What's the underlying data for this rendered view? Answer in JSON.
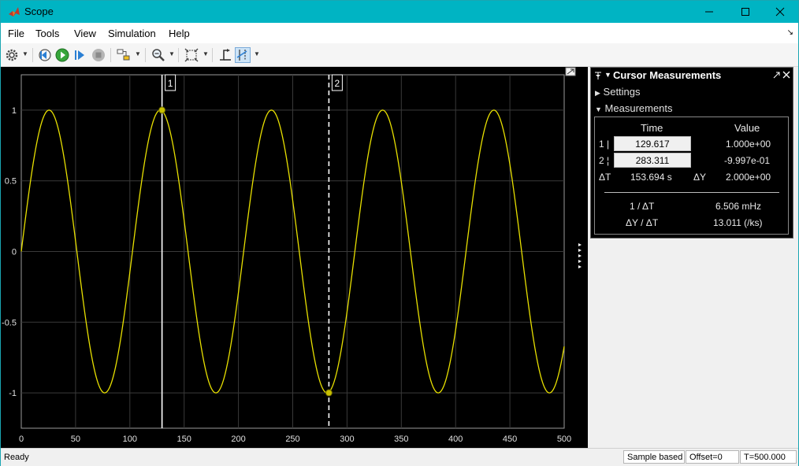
{
  "window": {
    "title": "Scope",
    "controls": {
      "minimize": "minimize-icon",
      "maximize": "maximize-icon",
      "close": "close-icon"
    }
  },
  "menu": {
    "items": [
      "File",
      "Tools",
      "View",
      "Simulation",
      "Help"
    ],
    "collapse_arrow": "↘"
  },
  "toolbar": {
    "icons": [
      "gear-icon",
      "step-back-icon",
      "run-icon",
      "step-forward-icon",
      "stop-icon",
      "highlight-icon",
      "zoom-icon",
      "autoscale-icon",
      "triggers-icon",
      "cursor-measurements-icon"
    ]
  },
  "plot": {
    "cursor1_label": "1",
    "cursor2_label": "2"
  },
  "chart_data": {
    "type": "line",
    "title": "",
    "xlabel": "",
    "ylabel": "",
    "xlim": [
      0,
      500
    ],
    "ylim": [
      -1.25,
      1.25
    ],
    "x_ticks": [
      0,
      50,
      100,
      150,
      200,
      250,
      300,
      350,
      400,
      450,
      500
    ],
    "y_ticks": [
      1,
      0.5,
      0,
      -0.5,
      -1
    ],
    "y_tick_labels": [
      "1",
      "0.5",
      "0",
      "-0.5",
      "-1"
    ],
    "grid": true,
    "series": [
      {
        "function": "sine",
        "amplitude": 1,
        "period": 102.4,
        "color": "#e8e000"
      }
    ],
    "cursors": [
      {
        "label": "1",
        "time": 129.617,
        "value": 1.0,
        "style": "solid",
        "color": "#ffffff"
      },
      {
        "label": "2",
        "time": 283.311,
        "value": -0.9997,
        "style": "dashed",
        "color": "#ffffff"
      }
    ]
  },
  "cursor_panel": {
    "title": "Cursor Measurements",
    "settings_label": "Settings",
    "measurements_label": "Measurements",
    "time_header": "Time",
    "value_header": "Value",
    "row1_label": "1 |",
    "row1_time": "129.617",
    "row1_value": "1.000e+00",
    "row2_label": "2 ¦",
    "row2_time": "283.311",
    "row2_value": "-9.997e-01",
    "dt_label": "ΔT",
    "dt_value": "153.694 s",
    "dy_label": "ΔY",
    "dy_value": "2.000e+00",
    "inv_dt_label": "1 / ΔT",
    "inv_dt_value": "6.506 mHz",
    "slope_label": "ΔY / ΔT",
    "slope_value": "13.011 (/ks)"
  },
  "status": {
    "ready": "Ready",
    "sample_mode": "Sample based",
    "offset": "Offset=0",
    "time": "T=500.000"
  }
}
